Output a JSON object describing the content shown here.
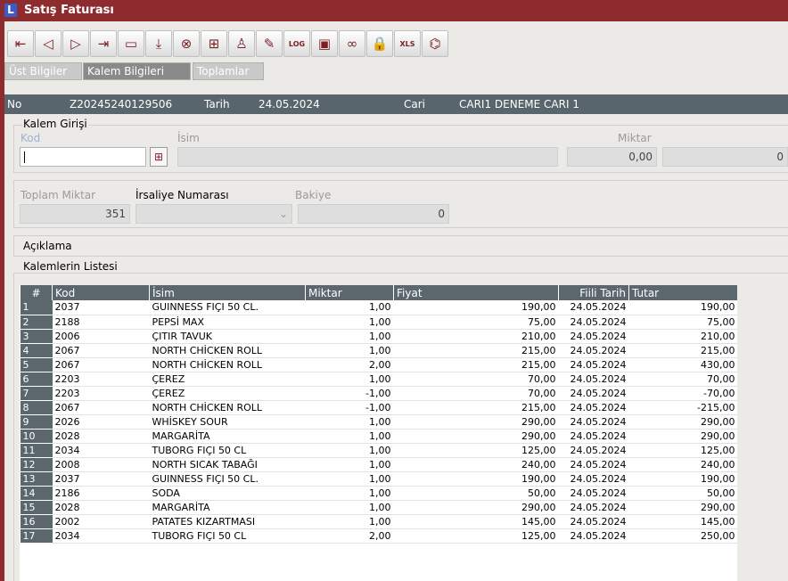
{
  "window": {
    "logo": "L",
    "title": "Satış Faturası"
  },
  "toolbar": {
    "buttons": [
      {
        "name": "first-record-icon",
        "glyph": "⇤"
      },
      {
        "name": "prev-record-icon",
        "glyph": "◁"
      },
      {
        "name": "next-record-icon",
        "glyph": "▷"
      },
      {
        "name": "last-record-icon",
        "glyph": "⇥"
      },
      {
        "name": "list-icon",
        "glyph": "▭"
      },
      {
        "name": "save-icon",
        "glyph": "⤓"
      },
      {
        "name": "delete-icon",
        "glyph": "⊗"
      },
      {
        "name": "add-folder-icon",
        "glyph": "⊞"
      },
      {
        "name": "user-icon",
        "glyph": "♙"
      },
      {
        "name": "edit-icon",
        "glyph": "✎"
      },
      {
        "name": "log-icon",
        "glyph": "LOG"
      },
      {
        "name": "print-icon",
        "glyph": "▣"
      },
      {
        "name": "link-icon",
        "glyph": "∞"
      },
      {
        "name": "lock-icon",
        "glyph": "🔒"
      },
      {
        "name": "xls-icon",
        "glyph": "XLS"
      },
      {
        "name": "report-icon",
        "glyph": "⌬"
      }
    ]
  },
  "tabs": [
    "Üst Bilgiler",
    "Kalem Bilgileri",
    "Toplamlar"
  ],
  "header": {
    "no_label": "No",
    "no_value": "Z20245240129506",
    "date_label": "Tarih",
    "date_value": "24.05.2024",
    "cari_label": "Cari",
    "cari_value": "CARI1 DENEME CARI 1"
  },
  "entry": {
    "group_title": "Kalem Girişi",
    "kod_label": "Kod",
    "isim_label": "İsim",
    "miktar_label": "Miktar",
    "miktar_value": "0,00",
    "extra_value": "0"
  },
  "totals": {
    "toplam_miktar_label": "Toplam Miktar",
    "toplam_miktar_value": "351",
    "irsaliye_label": "İrsaliye Numarası",
    "bakiye_label": "Bakiye",
    "bakiye_value": "0"
  },
  "aciklama_label": "Açıklama",
  "list": {
    "title": "Kalemlerin Listesi",
    "columns": [
      "#",
      "Kod",
      "İsim",
      "Miktar",
      "Fiyat",
      "Fiili Tarih",
      "Tutar"
    ],
    "rows": [
      [
        "1",
        "2037",
        "GUINNESS FIÇI 50 CL.",
        "1,00",
        "190,00",
        "24.05.2024",
        "190,00"
      ],
      [
        "2",
        "2188",
        "PEPSİ MAX",
        "1,00",
        "75,00",
        "24.05.2024",
        "75,00"
      ],
      [
        "3",
        "2006",
        "ÇITIR TAVUK",
        "1,00",
        "210,00",
        "24.05.2024",
        "210,00"
      ],
      [
        "4",
        "2067",
        "NORTH CHİCKEN ROLL",
        "1,00",
        "215,00",
        "24.05.2024",
        "215,00"
      ],
      [
        "5",
        "2067",
        "NORTH CHİCKEN ROLL",
        "2,00",
        "215,00",
        "24.05.2024",
        "430,00"
      ],
      [
        "6",
        "2203",
        "ÇEREZ",
        "1,00",
        "70,00",
        "24.05.2024",
        "70,00"
      ],
      [
        "7",
        "2203",
        "ÇEREZ",
        "-1,00",
        "70,00",
        "24.05.2024",
        "-70,00"
      ],
      [
        "8",
        "2067",
        "NORTH CHİCKEN ROLL",
        "-1,00",
        "215,00",
        "24.05.2024",
        "-215,00"
      ],
      [
        "9",
        "2026",
        "WHİSKEY SOUR",
        "1,00",
        "290,00",
        "24.05.2024",
        "290,00"
      ],
      [
        "10",
        "2028",
        "MARGARİTA",
        "1,00",
        "290,00",
        "24.05.2024",
        "290,00"
      ],
      [
        "11",
        "2034",
        "TUBORG FIÇI 50 CL",
        "1,00",
        "125,00",
        "24.05.2024",
        "125,00"
      ],
      [
        "12",
        "2008",
        "NORTH SICAK TABAĞI",
        "1,00",
        "240,00",
        "24.05.2024",
        "240,00"
      ],
      [
        "13",
        "2037",
        "GUINNESS FIÇI 50 CL.",
        "1,00",
        "190,00",
        "24.05.2024",
        "190,00"
      ],
      [
        "14",
        "2186",
        "SODA",
        "1,00",
        "50,00",
        "24.05.2024",
        "50,00"
      ],
      [
        "15",
        "2028",
        "MARGARİTA",
        "1,00",
        "290,00",
        "24.05.2024",
        "290,00"
      ],
      [
        "16",
        "2002",
        "PATATES KIZARTMASI",
        "1,00",
        "145,00",
        "24.05.2024",
        "145,00"
      ],
      [
        "17",
        "2034",
        "TUBORG FIÇI 50 CL",
        "2,00",
        "125,00",
        "24.05.2024",
        "250,00"
      ]
    ]
  }
}
